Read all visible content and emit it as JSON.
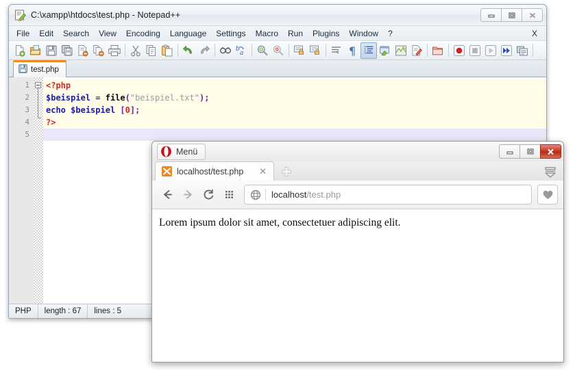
{
  "notepad": {
    "title": "C:\\xampp\\htdocs\\test.php - Notepad++",
    "icon": "notepad-plus-plus-icon",
    "window_buttons": [
      {
        "name": "minimize-button",
        "glyph": "minimize-icon"
      },
      {
        "name": "maximize-button",
        "glyph": "maximize-icon"
      },
      {
        "name": "close-button",
        "glyph": "close-icon"
      }
    ],
    "menu": [
      "File",
      "Edit",
      "Search",
      "View",
      "Encoding",
      "Language",
      "Settings",
      "Macro",
      "Run",
      "Plugins",
      "Window",
      "?"
    ],
    "menu_close_label": "X",
    "toolbar": [
      {
        "name": "new-file-icon",
        "group": 0
      },
      {
        "name": "open-file-icon",
        "group": 0
      },
      {
        "name": "save-icon",
        "group": 0
      },
      {
        "name": "save-all-icon",
        "group": 0
      },
      {
        "name": "close-file-icon",
        "group": 0
      },
      {
        "name": "close-all-icon",
        "group": 0
      },
      {
        "name": "print-icon",
        "group": 0
      },
      {
        "name": "cut-icon",
        "group": 1
      },
      {
        "name": "copy-icon",
        "group": 1
      },
      {
        "name": "paste-icon",
        "group": 1
      },
      {
        "name": "undo-icon",
        "group": 2
      },
      {
        "name": "redo-icon",
        "group": 2
      },
      {
        "name": "find-icon",
        "group": 3
      },
      {
        "name": "replace-icon",
        "group": 3
      },
      {
        "name": "zoom-in-icon",
        "group": 4
      },
      {
        "name": "zoom-out-icon",
        "group": 4
      },
      {
        "name": "sync-vertical-scroll-icon",
        "group": 5
      },
      {
        "name": "sync-horizontal-scroll-icon",
        "group": 5
      },
      {
        "name": "word-wrap-icon",
        "group": 6
      },
      {
        "name": "show-all-chars-icon",
        "group": 6
      },
      {
        "name": "indent-guide-icon",
        "group": 7,
        "selected": true
      },
      {
        "name": "user-defined-language-icon",
        "group": 7
      },
      {
        "name": "document-map-icon",
        "group": 7
      },
      {
        "name": "function-list-icon",
        "group": 7
      },
      {
        "name": "folder-as-workspace-icon",
        "group": 8
      },
      {
        "name": "macro-record-icon",
        "group": 9
      },
      {
        "name": "macro-stop-icon",
        "group": 9
      },
      {
        "name": "macro-play-icon",
        "group": 9
      },
      {
        "name": "macro-play-multiple-icon",
        "group": 9
      },
      {
        "name": "macro-save-icon",
        "group": 9
      }
    ],
    "tab": {
      "label": "test.php",
      "icon": "saved-file-icon"
    },
    "editor": {
      "line_numbers": [
        "1",
        "2",
        "3",
        "4",
        "5"
      ],
      "lines": [
        {
          "n": 1,
          "tokens": [
            {
              "t": "<?php",
              "c": "c-tag"
            }
          ],
          "highlight": "fold"
        },
        {
          "n": 2,
          "tokens": [
            {
              "t": "$beispiel",
              "c": "c-var"
            },
            {
              "t": " = ",
              "c": "c-op"
            },
            {
              "t": "file",
              "c": "c-fn"
            },
            {
              "t": "(",
              "c": "c-par"
            },
            {
              "t": "\"beispiel.txt\"",
              "c": "c-str"
            },
            {
              "t": ")",
              "c": "c-par"
            },
            {
              "t": ";",
              "c": "c-par"
            }
          ]
        },
        {
          "n": 3,
          "tokens": [
            {
              "t": "echo",
              "c": "c-kw"
            },
            {
              "t": " ",
              "c": "c-op"
            },
            {
              "t": "$beispiel",
              "c": "c-var"
            },
            {
              "t": " ",
              "c": "c-op"
            },
            {
              "t": "[",
              "c": "c-brk"
            },
            {
              "t": "0",
              "c": "c-num"
            },
            {
              "t": "]",
              "c": "c-brk"
            },
            {
              "t": ";",
              "c": "c-par"
            }
          ]
        },
        {
          "n": 4,
          "tokens": [
            {
              "t": "?>",
              "c": "c-tag"
            }
          ]
        },
        {
          "n": 5,
          "tokens": [
            {
              "t": "",
              "c": "c-op"
            }
          ],
          "current": true
        }
      ]
    },
    "status": {
      "language": "PHP",
      "length": "length : 67",
      "lines": "lines : 5"
    }
  },
  "opera": {
    "menu_button_label": "Menü",
    "logo": "opera-logo-icon",
    "window_buttons": [
      {
        "name": "minimize-button",
        "glyph": "minimize-icon"
      },
      {
        "name": "maximize-button",
        "glyph": "maximize-icon"
      },
      {
        "name": "close-button",
        "glyph": "close-icon"
      }
    ],
    "tab": {
      "title": "localhost/test.php",
      "favicon": "xampp-favicon",
      "close_glyph": "close-icon"
    },
    "new_tab_glyph": "plus-icon",
    "nav": {
      "back_icon": "arrow-left-icon",
      "forward_icon": "arrow-right-icon",
      "reload_icon": "reload-icon",
      "speed_dial_icon": "grid-icon",
      "page_badge_icon": "globe-icon",
      "address_host": "localhost",
      "address_path": "/test.php",
      "bookmark_icon": "heart-icon",
      "sidebar_menu_icon": "menu-stack-icon"
    },
    "page": {
      "body_text": "Lorem ipsum dolor sit amet, consectetuer adipiscing elit."
    }
  },
  "colors": {
    "npp_tab_accent": "#f08a24",
    "opera_red": "#c63a22",
    "xampp_orange": "#f08a24",
    "code_tag": "#d4262a",
    "code_var": "#1b1bb0",
    "code_string": "#9b9b9b",
    "code_bracket": "#7b1fa2"
  }
}
